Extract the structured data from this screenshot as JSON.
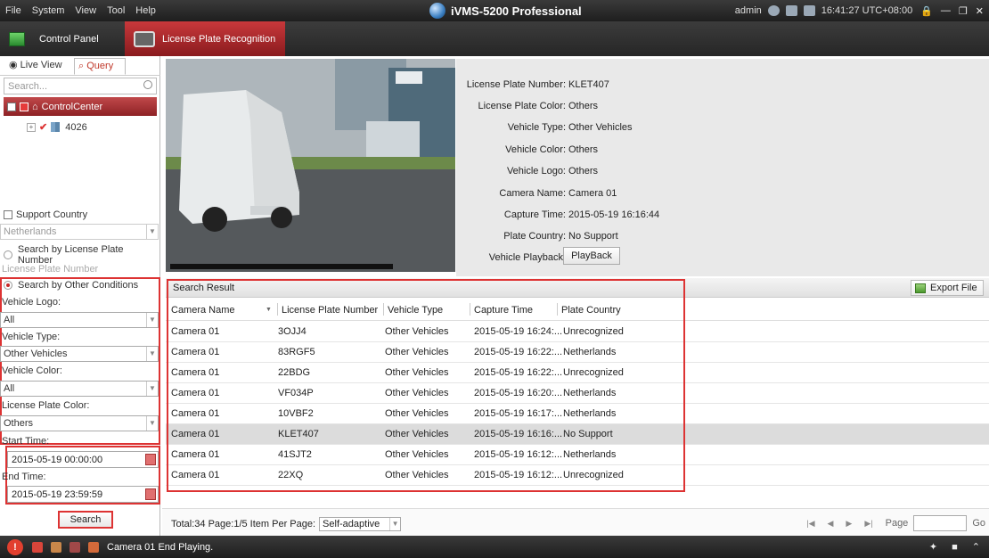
{
  "menu": [
    "File",
    "System",
    "View",
    "Tool",
    "Help"
  ],
  "app_title": "iVMS-5200 Professional",
  "titlebar": {
    "user": "admin",
    "clock": "16:41:27 UTC+08:00"
  },
  "tabs": {
    "control_panel": "Control Panel",
    "lpr": "License Plate Recognition"
  },
  "left": {
    "tab_live": "Live View",
    "tab_query": "Query",
    "search_placeholder": "Search...",
    "root_node": "ControlCenter",
    "child_node": "4026",
    "support_country_label": "Support Country",
    "country_value": "Netherlands",
    "search_by_plate_label": "Search by License Plate Number",
    "plate_number_placeholder": "License Plate Number",
    "search_by_other_label": "Search by Other Conditions",
    "vehicle_logo_label": "Vehicle Logo:",
    "vehicle_logo_value": "All",
    "vehicle_type_label": "Vehicle Type:",
    "vehicle_type_value": "Other Vehicles",
    "vehicle_color_label": "Vehicle Color:",
    "vehicle_color_value": "All",
    "plate_color_label": "License Plate Color:",
    "plate_color_value": "Others",
    "start_time_label": "Start Time:",
    "start_time_value": "2015-05-19 00:00:00",
    "end_time_label": "End Time:",
    "end_time_value": "2015-05-19 23:59:59",
    "search_button": "Search"
  },
  "detail": {
    "fields": [
      {
        "key": "License Plate Number:",
        "value": "KLET407"
      },
      {
        "key": "License Plate Color:",
        "value": "Others"
      },
      {
        "key": "Vehicle Type:",
        "value": "Other Vehicles"
      },
      {
        "key": "Vehicle Color:",
        "value": "Others"
      },
      {
        "key": "Vehicle Logo:",
        "value": "Others"
      },
      {
        "key": "Camera Name:",
        "value": "Camera 01"
      },
      {
        "key": "Capture Time:",
        "value": "2015-05-19 16:16:44"
      },
      {
        "key": "Plate Country:",
        "value": "No Support"
      },
      {
        "key": "Vehicle Playback:",
        "value": ""
      }
    ],
    "playback_button": "PlayBack"
  },
  "results": {
    "title": "Search Result",
    "export_button": "Export File",
    "columns": [
      "Camera Name",
      "License Plate Number",
      "Vehicle Type",
      "Capture Time",
      "Plate Country"
    ],
    "rows": [
      [
        "Camera 01",
        "3OJJ4",
        "Other Vehicles",
        "2015-05-19 16:24:...",
        "Unrecognized"
      ],
      [
        "Camera 01",
        "83RGF5",
        "Other Vehicles",
        "2015-05-19 16:22:...",
        "Netherlands"
      ],
      [
        "Camera 01",
        "22BDG",
        "Other Vehicles",
        "2015-05-19 16:22:...",
        "Unrecognized"
      ],
      [
        "Camera 01",
        "VF034P",
        "Other Vehicles",
        "2015-05-19 16:20:...",
        "Netherlands"
      ],
      [
        "Camera 01",
        "10VBF2",
        "Other Vehicles",
        "2015-05-19 16:17:...",
        "Netherlands"
      ],
      [
        "Camera 01",
        "KLET407",
        "Other Vehicles",
        "2015-05-19 16:16:...",
        "No Support"
      ],
      [
        "Camera 01",
        "41SJT2",
        "Other Vehicles",
        "2015-05-19 16:12:...",
        "Netherlands"
      ],
      [
        "Camera 01",
        "22XQ",
        "Other Vehicles",
        "2015-05-19 16:12:...",
        "Unrecognized"
      ]
    ],
    "selected_row": 5
  },
  "footer": {
    "summary": "Total:34  Page:1/5  Item Per Page:",
    "items_per_page": "Self-adaptive",
    "page_label": "Page",
    "go_button": "Go"
  },
  "status": {
    "message": "Camera 01 End Playing."
  },
  "colors": {
    "accent": "#c0393b",
    "titlebar": "#2a2a2a",
    "highlight_box": "#dd3333"
  }
}
